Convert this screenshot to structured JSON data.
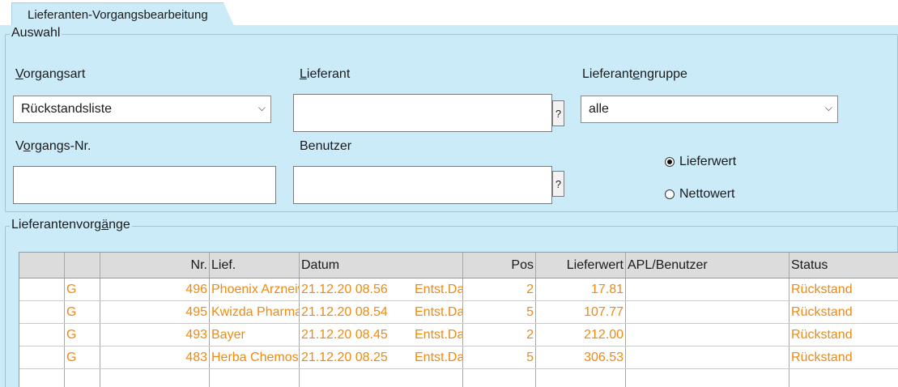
{
  "tab": {
    "title": "Lieferanten-Vorgangsbearbeitung"
  },
  "auswahl": {
    "legend": "Auswahl",
    "vorgangsart": {
      "label_mnemonic": "V",
      "label_rest": "organgsart",
      "value": "Rückstandsliste"
    },
    "lieferant": {
      "label_mnemonic": "L",
      "label_rest": "ieferant",
      "value": "",
      "help": "?"
    },
    "lieferantengruppe": {
      "label_pre": "Lieferant",
      "label_mnemonic": "e",
      "label_rest": "ngruppe",
      "value": "alle"
    },
    "vorgangsnr": {
      "label_pre": "V",
      "label_mnemonic": "o",
      "label_rest": "rgangs-Nr.",
      "value": ""
    },
    "benutzer": {
      "label": "Benutzer",
      "value": "",
      "help": "?"
    },
    "radio": {
      "option1": "Lieferwert",
      "option2": "Nettowert",
      "selected": "Lieferwert"
    }
  },
  "vorgaenge": {
    "legend_pre": "Lieferantenvorg",
    "legend_mnemonic": "ä",
    "legend_rest": "nge",
    "columns": [
      "",
      "",
      "Nr.",
      "Lief.",
      "Datum",
      "",
      "Pos",
      "Lieferwert",
      "APL/Benutzer",
      "Status"
    ],
    "rows": [
      {
        "flag": "G",
        "nr": "496",
        "lief": "Phoenix Arzneiwaren",
        "datum": "21.12.20 08.56",
        "art": "Entst.Dat.",
        "pos": "2",
        "lieferwert": "17.81",
        "apl": "",
        "status": "Rückstand"
      },
      {
        "flag": "G",
        "nr": "495",
        "lief": "Kwizda Pharma",
        "datum": "21.12.20 08.54",
        "art": "Entst.Dat.",
        "pos": "5",
        "lieferwert": "107.77",
        "apl": "",
        "status": "Rückstand"
      },
      {
        "flag": "G",
        "nr": "493",
        "lief": "Bayer",
        "datum": "21.12.20 08.45",
        "art": "Entst.Dat.",
        "pos": "2",
        "lieferwert": "212.00",
        "apl": "",
        "status": "Rückstand"
      },
      {
        "flag": "G",
        "nr": "483",
        "lief": "Herba Chemosan",
        "datum": "21.12.20 08.25",
        "art": "Entst.Dat.",
        "pos": "5",
        "lieferwert": "306.53",
        "apl": "",
        "status": "Rückstand"
      }
    ]
  },
  "colors": {
    "panel": "#ccebf9",
    "row_text": "#ef8a10",
    "header_bg": "#dcdcdc"
  }
}
